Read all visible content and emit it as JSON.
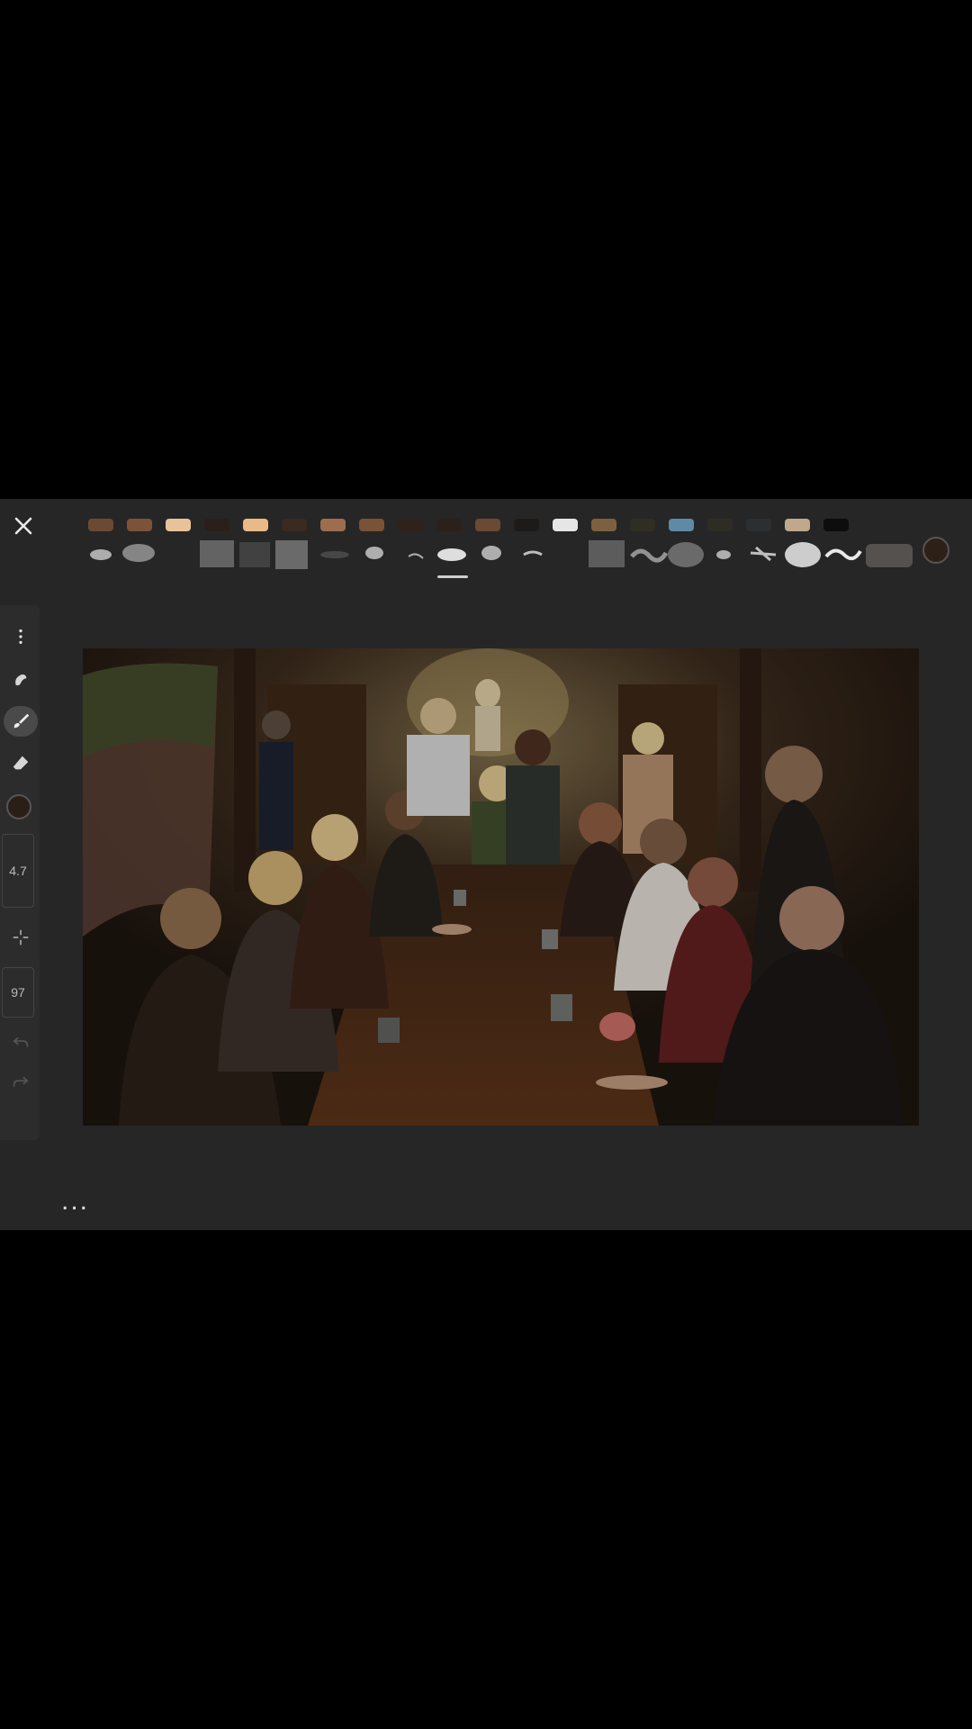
{
  "toolbar": {
    "close_icon": "close-icon",
    "swatches": [
      "#6b4a33",
      "#7a5338",
      "#e8c39a",
      "#2a1f1a",
      "#e9b987",
      "#3a2a20",
      "#9c6e4e",
      "#7a5236",
      "#2e221b",
      "#2b211b",
      "#6a4a34",
      "#1d1b1a",
      "#e6e6e6",
      "#7c6140",
      "#2f2e22",
      "#5e8aa6",
      "#2e2d23",
      "#2c2f31",
      "#bfa88c",
      "#0d0d0d"
    ],
    "brushes": [
      "spray-brush",
      "cloud-brush",
      "empty",
      "splatter-brush",
      "noise-brush",
      "texture-brush",
      "soft-brush",
      "blob-brush",
      "thin-line-brush",
      "oval-brush",
      "fluff-brush",
      "stroke-brush",
      "empty",
      "scribble-brush",
      "wave-brush",
      "smoke-brush",
      "small-brush",
      "splash-brush",
      "big-cloud-brush",
      "squiggle-brush",
      "rect-brush"
    ],
    "active_brush_index": 9,
    "current_color": "#2d2016"
  },
  "tools": {
    "menu_icon": "more-vertical-icon",
    "smudge_icon": "smudge-icon",
    "brush_icon": "brush-icon",
    "eraser_icon": "eraser-icon",
    "color": "#2a1f17",
    "size_value": "4.7",
    "eyedropper_icon": "crosshair-icon",
    "opacity_value": "97",
    "undo_icon": "undo-icon",
    "redo_icon": "redo-icon"
  },
  "bottom": {
    "more_label": "..."
  }
}
